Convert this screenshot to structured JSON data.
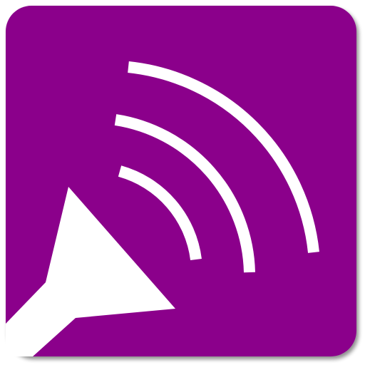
{
  "icon": {
    "name": "broadcast-signal-icon",
    "background_color": "#8B008B",
    "foreground_color": "#FFFFFF",
    "shadow_color": "#B9B9B9",
    "signal_arc_count": 3
  }
}
